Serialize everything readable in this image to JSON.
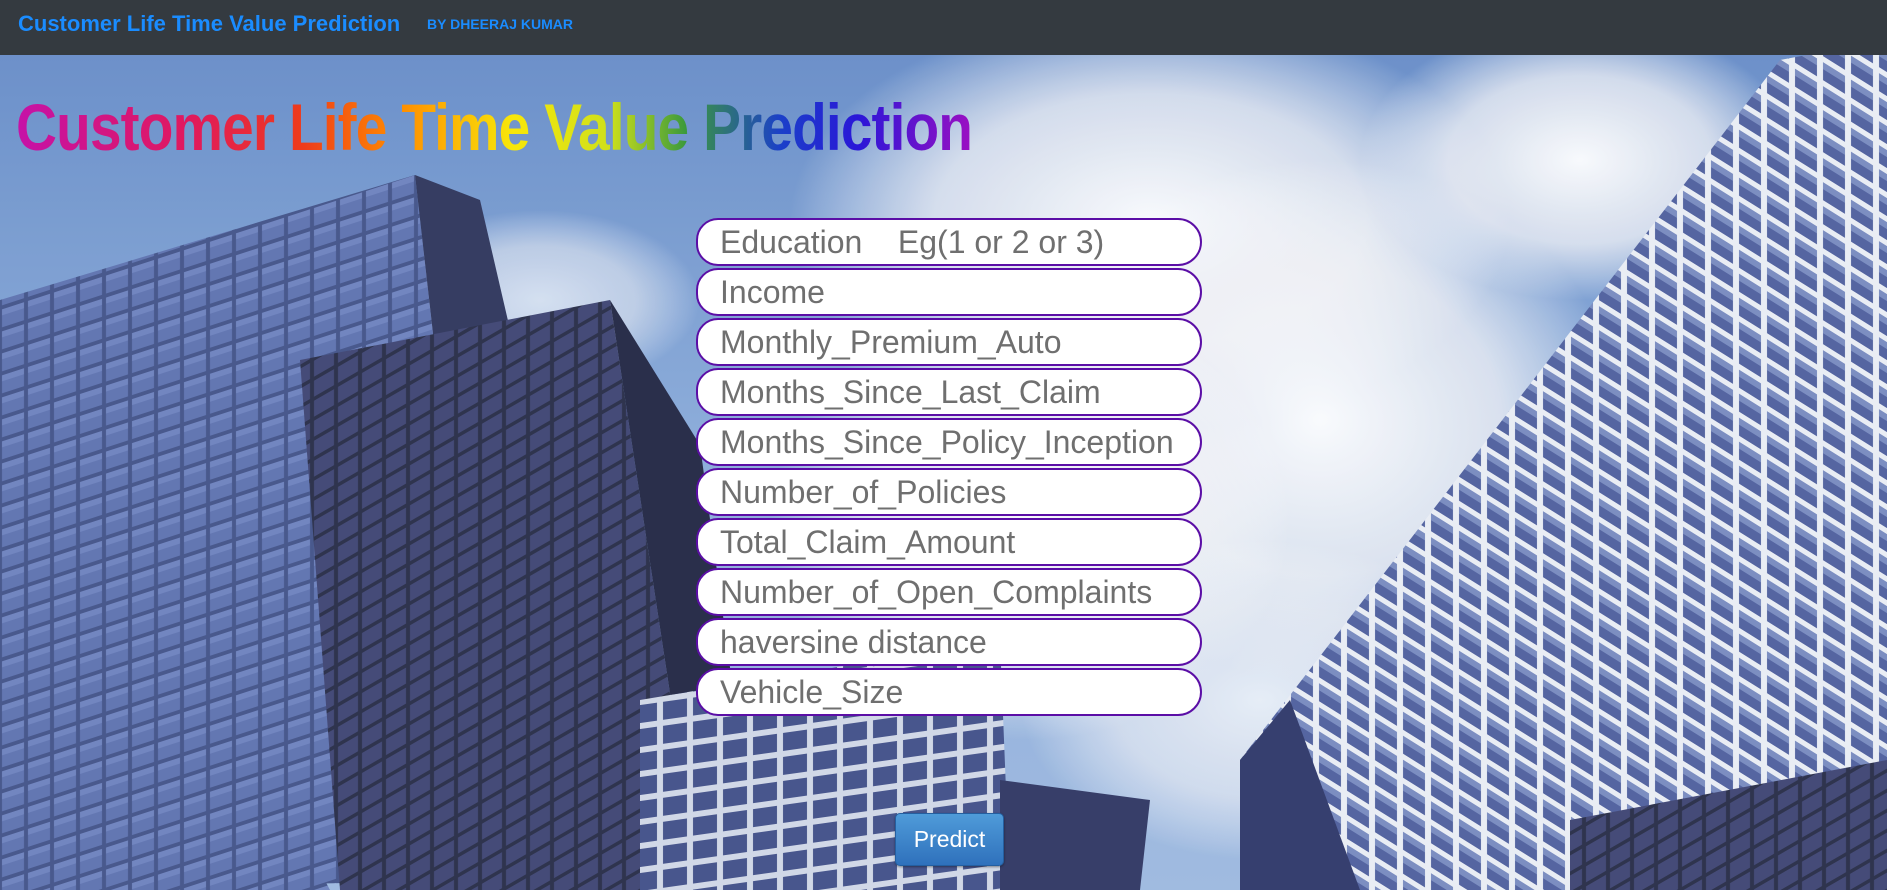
{
  "navbar": {
    "brand": "Customer Life Time Value Prediction",
    "byline": "BY DHEERAJ KUMAR"
  },
  "heading": "Customer Life Time Value Prediction",
  "form": {
    "fields": [
      {
        "placeholder": "Education    Eg(1 or 2 or 3)",
        "value": ""
      },
      {
        "placeholder": "Income",
        "value": ""
      },
      {
        "placeholder": "Monthly_Premium_Auto",
        "value": ""
      },
      {
        "placeholder": "Months_Since_Last_Claim",
        "value": ""
      },
      {
        "placeholder": "Months_Since_Policy_Inception",
        "value": ""
      },
      {
        "placeholder": "Number_of_Policies",
        "value": ""
      },
      {
        "placeholder": "Total_Claim_Amount",
        "value": ""
      },
      {
        "placeholder": "Number_of_Open_Complaints",
        "value": ""
      },
      {
        "placeholder": "haversine distance",
        "value": ""
      },
      {
        "placeholder": "Vehicle_Size",
        "value": ""
      }
    ],
    "submit_label": "Predict"
  },
  "colors": {
    "navbar_bg": "#343a40",
    "brand": "#1a8cff",
    "field_border": "#5b0ea6",
    "button": "#3d86cc"
  }
}
